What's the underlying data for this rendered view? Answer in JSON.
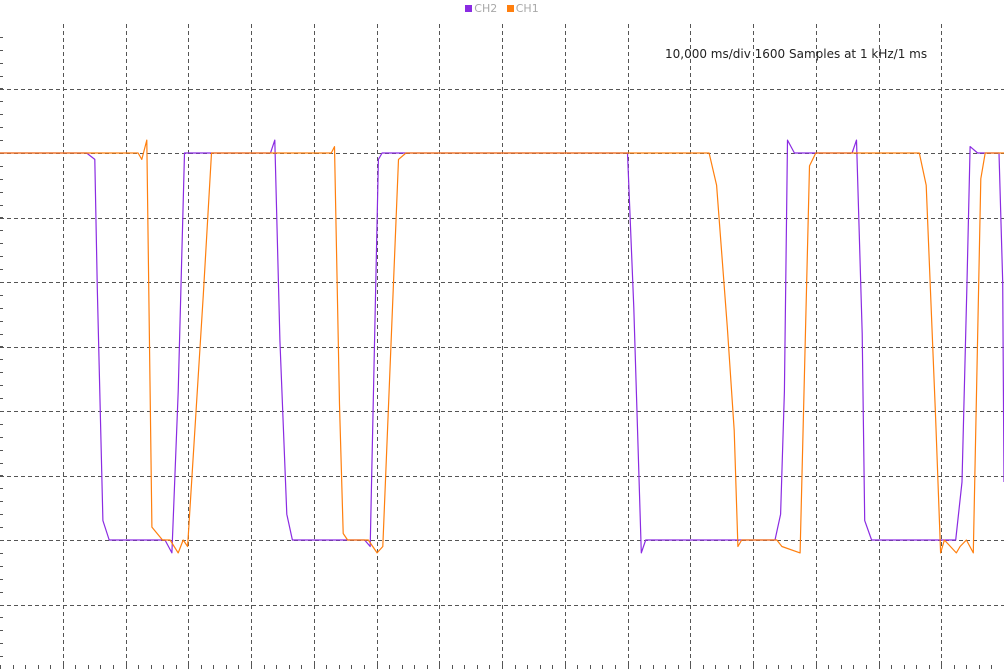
{
  "legend": [
    {
      "name": "CH2",
      "color": "#8a2be2"
    },
    {
      "name": "CH1",
      "color": "#ff7f0e"
    }
  ],
  "info_text": "10,000 ms/div 1600 Samples at 1 kHz/1 ms",
  "chart_data": {
    "type": "line",
    "title": "",
    "xlabel": "",
    "ylabel": "",
    "grid": true,
    "legend_position": "top-center",
    "xlim": [
      0,
      160
    ],
    "ylim": [
      -5,
      5
    ],
    "series": [
      {
        "name": "CH2",
        "color": "#8a2be2",
        "points": [
          [
            0,
            3
          ],
          [
            13.8,
            3
          ],
          [
            15.1,
            2.9
          ],
          [
            15.5,
            0.9
          ],
          [
            16.4,
            -2.7
          ],
          [
            17.4,
            -3
          ],
          [
            26.3,
            -3
          ],
          [
            27.4,
            -3.2
          ],
          [
            28.4,
            -0.7
          ],
          [
            29.4,
            3
          ],
          [
            34.6,
            3
          ],
          [
            43.1,
            3
          ],
          [
            43.8,
            3.2
          ],
          [
            44.6,
            0.1
          ],
          [
            45.7,
            -2.6
          ],
          [
            46.6,
            -3
          ],
          [
            58.1,
            -3
          ],
          [
            59.0,
            -3.1
          ],
          [
            60.3,
            2.9
          ],
          [
            60.9,
            3
          ],
          [
            100,
            3
          ],
          [
            101.0,
            0.6
          ],
          [
            102.2,
            -3.2
          ],
          [
            102.9,
            -3
          ],
          [
            123.5,
            -3
          ],
          [
            124.4,
            -2.6
          ],
          [
            125.0,
            -0.7
          ],
          [
            125.5,
            3.2
          ],
          [
            126.6,
            3
          ],
          [
            135.8,
            3
          ],
          [
            136.5,
            3.2
          ],
          [
            137.4,
            0.2
          ],
          [
            137.8,
            -2.7
          ],
          [
            138.9,
            -3
          ],
          [
            152.3,
            -3
          ],
          [
            153.3,
            -2.1
          ],
          [
            154.1,
            1.0
          ],
          [
            154.6,
            3.1
          ],
          [
            155.8,
            3
          ],
          [
            159.2,
            3
          ],
          [
            159.8,
            1.0
          ],
          [
            160,
            -2.1
          ]
        ]
      },
      {
        "name": "CH1",
        "color": "#ff7f0e",
        "points": [
          [
            0,
            3
          ],
          [
            22.0,
            3
          ],
          [
            22.6,
            2.9
          ],
          [
            23.4,
            3.2
          ],
          [
            24.2,
            -2.8
          ],
          [
            25.9,
            -3
          ],
          [
            27.1,
            -3
          ],
          [
            28.4,
            -3.2
          ],
          [
            29.2,
            -3
          ],
          [
            29.9,
            -3.1
          ],
          [
            32.4,
            0.8
          ],
          [
            33.7,
            3
          ],
          [
            52.8,
            3
          ],
          [
            53.3,
            3.1
          ],
          [
            54.1,
            -0.9
          ],
          [
            54.7,
            -2.9
          ],
          [
            55.4,
            -3
          ],
          [
            58.7,
            -3
          ],
          [
            60.1,
            -3.2
          ],
          [
            61.0,
            -3.1
          ],
          [
            63.5,
            2.9
          ],
          [
            64.7,
            3
          ],
          [
            113,
            3
          ],
          [
            114.2,
            2.5
          ],
          [
            115.9,
            0.3
          ],
          [
            117.0,
            -1.3
          ],
          [
            117.6,
            -3.1
          ],
          [
            118.2,
            -3
          ],
          [
            123.8,
            -3
          ],
          [
            124.6,
            -3.1
          ],
          [
            127.5,
            -3.2
          ],
          [
            129.0,
            2.8
          ],
          [
            130.0,
            3
          ],
          [
            146.5,
            3
          ],
          [
            147.6,
            2.5
          ],
          [
            149.1,
            -1.1
          ],
          [
            149.9,
            -3.2
          ],
          [
            150.5,
            -3
          ],
          [
            152.4,
            -3.2
          ],
          [
            153.0,
            -3.1
          ],
          [
            154.0,
            -3
          ],
          [
            155.1,
            -3.2
          ],
          [
            156.3,
            2.6
          ],
          [
            157.0,
            3
          ],
          [
            160,
            3
          ]
        ]
      }
    ]
  }
}
